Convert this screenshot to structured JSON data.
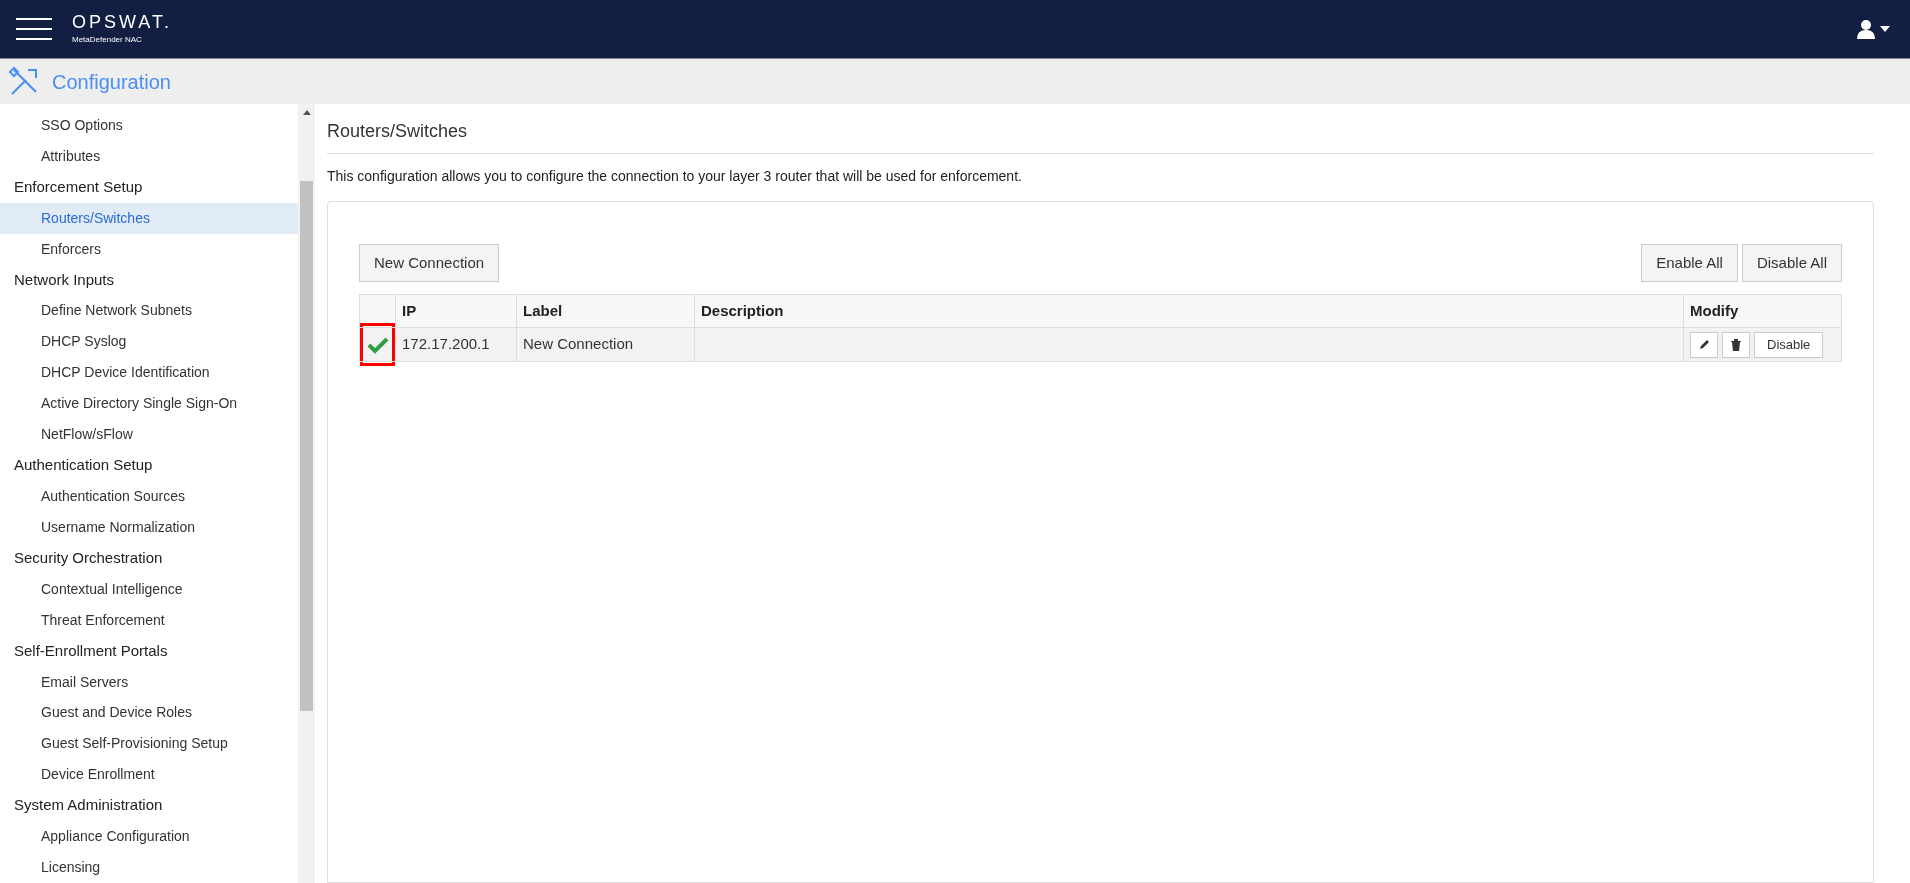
{
  "header": {
    "logo": "OPSWAT.",
    "product": "MetaDefender NAC"
  },
  "config_bar": {
    "title": "Configuration"
  },
  "sidebar": {
    "items": [
      {
        "kind": "item",
        "label": "SSO Options",
        "selected": false
      },
      {
        "kind": "item",
        "label": "Attributes",
        "selected": false
      },
      {
        "kind": "section",
        "label": "Enforcement Setup"
      },
      {
        "kind": "item",
        "label": "Routers/Switches",
        "selected": true
      },
      {
        "kind": "item",
        "label": "Enforcers",
        "selected": false
      },
      {
        "kind": "section",
        "label": "Network Inputs"
      },
      {
        "kind": "item",
        "label": "Define Network Subnets",
        "selected": false
      },
      {
        "kind": "item",
        "label": "DHCP Syslog",
        "selected": false
      },
      {
        "kind": "item",
        "label": "DHCP Device Identification",
        "selected": false
      },
      {
        "kind": "item",
        "label": "Active Directory Single Sign-On",
        "selected": false
      },
      {
        "kind": "item",
        "label": "NetFlow/sFlow",
        "selected": false
      },
      {
        "kind": "section",
        "label": "Authentication Setup"
      },
      {
        "kind": "item",
        "label": "Authentication Sources",
        "selected": false
      },
      {
        "kind": "item",
        "label": "Username Normalization",
        "selected": false
      },
      {
        "kind": "section",
        "label": "Security Orchestration"
      },
      {
        "kind": "item",
        "label": "Contextual Intelligence",
        "selected": false
      },
      {
        "kind": "item",
        "label": "Threat Enforcement",
        "selected": false
      },
      {
        "kind": "section",
        "label": "Self-Enrollment Portals"
      },
      {
        "kind": "item",
        "label": "Email Servers",
        "selected": false
      },
      {
        "kind": "item",
        "label": "Guest and Device Roles",
        "selected": false
      },
      {
        "kind": "item",
        "label": "Guest Self-Provisioning Setup",
        "selected": false
      },
      {
        "kind": "item",
        "label": "Device Enrollment",
        "selected": false
      },
      {
        "kind": "section",
        "label": "System Administration"
      },
      {
        "kind": "item",
        "label": "Appliance Configuration",
        "selected": false
      },
      {
        "kind": "item",
        "label": "Licensing",
        "selected": false
      }
    ]
  },
  "page": {
    "title": "Routers/Switches",
    "description": "This configuration allows you to configure the connection to your layer 3 router that will be used for enforcement.",
    "new_button": "New Connection",
    "enable_all": "Enable All",
    "disable_all": "Disable All",
    "table": {
      "columns": [
        "IP",
        "Label",
        "Description",
        "Modify"
      ],
      "rows": [
        {
          "enabled": true,
          "highlighted": true,
          "ip": "172.17.200.1",
          "label": "New Connection",
          "description": "",
          "action": "Disable"
        }
      ]
    }
  }
}
